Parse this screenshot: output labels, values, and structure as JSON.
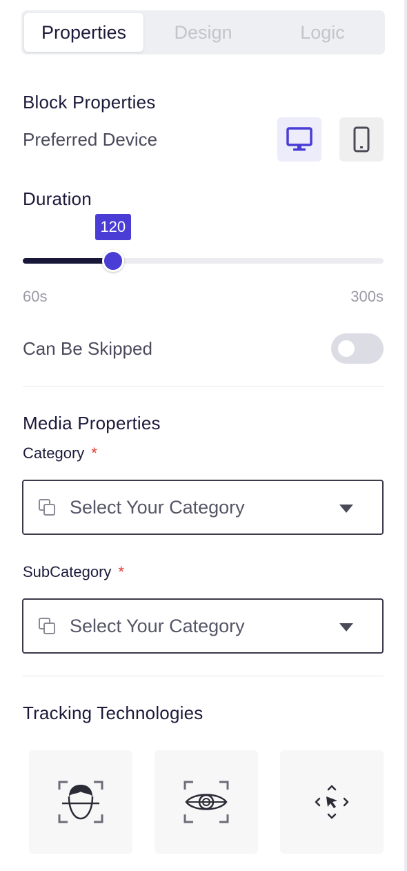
{
  "tabs": [
    "Properties",
    "Design",
    "Logic"
  ],
  "block": {
    "title": "Block Properties",
    "preferred_device_label": "Preferred Device",
    "devices": [
      "desktop-icon",
      "mobile-icon"
    ]
  },
  "duration": {
    "title": "Duration",
    "value": "120",
    "min_label": "60s",
    "max_label": "300s",
    "min": 60,
    "max": 300
  },
  "skip": {
    "label": "Can Be Skipped",
    "enabled": false
  },
  "media": {
    "title": "Media Properties",
    "category_label": "Category",
    "category_required": "*",
    "category_placeholder": "Select Your Category",
    "subcategory_label": "SubCategory",
    "subcategory_required": "*",
    "subcategory_placeholder": "Select Your Category"
  },
  "tracking": {
    "title": "Tracking Technologies",
    "options": [
      "face-tracking-icon",
      "eye-tracking-icon",
      "mouse-tracking-icon"
    ]
  },
  "colors": {
    "accent": "#4a3dd6",
    "text": "#1c1a3a",
    "required": "#e03a2f"
  }
}
